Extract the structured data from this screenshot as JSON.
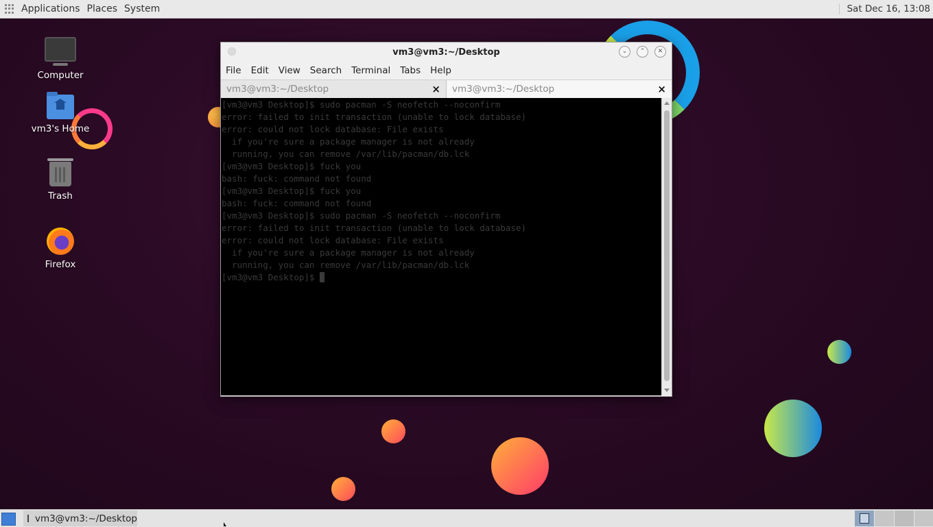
{
  "top_panel": {
    "menus": [
      "Applications",
      "Places",
      "System"
    ],
    "clock": "Sat Dec 16, 13:08"
  },
  "desktop": {
    "icons": [
      {
        "label": "Computer",
        "icon": "computer-icon"
      },
      {
        "label": "vm3's Home",
        "icon": "home-folder-icon"
      },
      {
        "label": "Trash",
        "icon": "trash-icon"
      },
      {
        "label": "Firefox",
        "icon": "firefox-icon"
      }
    ]
  },
  "terminal": {
    "title": "vm3@vm3:~/Desktop",
    "menu": [
      "File",
      "Edit",
      "View",
      "Search",
      "Terminal",
      "Tabs",
      "Help"
    ],
    "tabs": [
      {
        "label": "vm3@vm3:~/Desktop",
        "close": "×"
      },
      {
        "label": "vm3@vm3:~/Desktop",
        "close": "×"
      }
    ],
    "lines": [
      "[vm3@vm3 Desktop]$ sudo pacman -S neofetch --noconfirm",
      "error: failed to init transaction (unable to lock database)",
      "error: could not lock database: File exists",
      "  if you're sure a package manager is not already",
      "  running, you can remove /var/lib/pacman/db.lck",
      "[vm3@vm3 Desktop]$ fuck you",
      "bash: fuck: command not found",
      "[vm3@vm3 Desktop]$ fuck you",
      "bash: fuck: command not found",
      "[vm3@vm3 Desktop]$ sudo pacman -S neofetch --noconfirm",
      "error: failed to init transaction (unable to lock database)",
      "error: could not lock database: File exists",
      "  if you're sure a package manager is not already",
      "  running, you can remove /var/lib/pacman/db.lck"
    ],
    "prompt": "[vm3@vm3 Desktop]$ "
  },
  "taskbar": {
    "task_label": "vm3@vm3:~/Desktop"
  },
  "colors": {
    "terminal_bg": "#000000",
    "terminal_text": "#3a3a3a",
    "panel_bg": "#e9e9e9",
    "accent": "#3f7fd6"
  }
}
